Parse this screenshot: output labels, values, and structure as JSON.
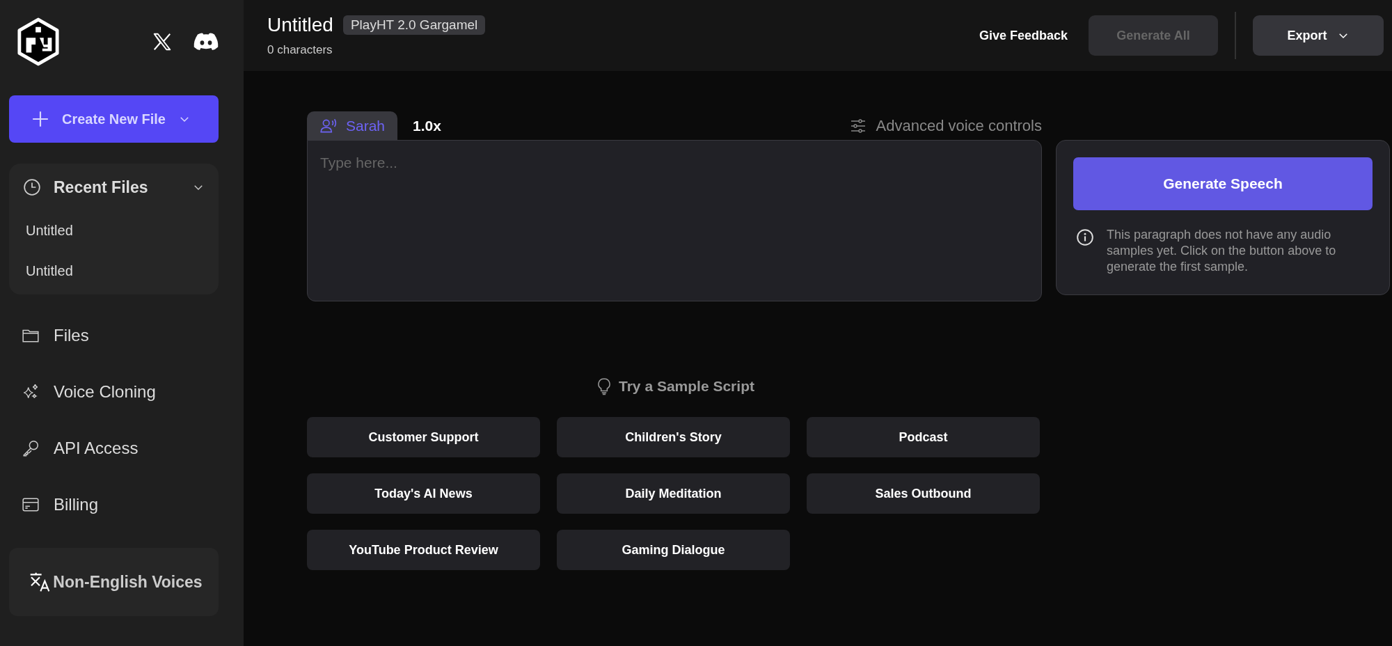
{
  "sidebar": {
    "create_button": {
      "label": "Create New File"
    },
    "recent_files": {
      "title": "Recent Files",
      "expanded": true,
      "items": [
        "Untitled",
        "Untitled"
      ]
    },
    "nav_items": [
      {
        "kind": "files",
        "label": "Files"
      },
      {
        "kind": "cloning",
        "label": "Voice Cloning"
      },
      {
        "kind": "api",
        "label": "API Access"
      },
      {
        "kind": "billing",
        "label": "Billing"
      }
    ],
    "language_button": {
      "label": "Non-English Voices"
    }
  },
  "header": {
    "title": "Untitled",
    "model_badge": "PlayHT 2.0 Gargamel",
    "character_count": "0 characters",
    "actions": [
      {
        "kind": "link",
        "label": "Give Feedback",
        "disabled": false
      },
      {
        "kind": "button",
        "label": "Generate All",
        "disabled": true
      },
      {
        "kind": "dropdown",
        "label": "Export",
        "disabled": false
      }
    ]
  },
  "editor": {
    "voice_tab": {
      "label": "Sarah",
      "selected": true
    },
    "speed": "1.0x",
    "advanced_controls": "Advanced voice controls",
    "placeholder": "Type here..."
  },
  "generate_panel": {
    "button": "Generate Speech",
    "info": "This paragraph does not have any audio samples yet. Click on the button above to generate the first sample."
  },
  "samples": {
    "title": "Try a Sample Script",
    "items": [
      "Customer Support",
      "Children's Story",
      "Podcast",
      "Today's AI News",
      "Daily Meditation",
      "Sales Outbound",
      "YouTube Product Review",
      "Gaming Dialogue"
    ]
  }
}
